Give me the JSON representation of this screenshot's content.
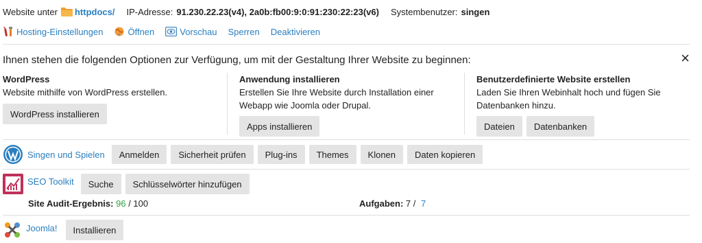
{
  "header": {
    "website_prefix": "Website unter",
    "folder_link": "httpdocs/",
    "ip_label": "IP-Adresse:",
    "ip_value": "91.230.22.23(v4), 2a0b:fb00:9:0:91:230:22:23(v6)",
    "user_label": "Systembenutzer:",
    "user_value": "singen"
  },
  "actions": {
    "hosting": "Hosting-Einstellungen",
    "open": "Öffnen",
    "preview": "Vorschau",
    "lock": "Sperren",
    "deactivate": "Deaktivieren"
  },
  "options": {
    "intro": "Ihnen stehen die folgenden Optionen zur Verfügung, um mit der Gestaltung Ihrer Website zu beginnen:",
    "close": "×",
    "wordpress": {
      "title": "WordPress",
      "text": "Website mithilfe von WordPress erstellen.",
      "button": "WordPress installieren"
    },
    "app": {
      "title": "Anwendung installieren",
      "text1": "Erstellen Sie Ihre Website durch Installation einer",
      "text2": "Webapp wie Joomla oder Drupal.",
      "button": "Apps installieren"
    },
    "custom": {
      "title": "Benutzerdefinierte Website erstellen",
      "text1": "Laden Sie Ihren Webinhalt hoch und fügen Sie",
      "text2": "Datenbanken hinzu.",
      "button_files": "Dateien",
      "button_db": "Datenbanken"
    }
  },
  "wp_site": {
    "name": "Singen und Spielen",
    "buttons": [
      "Anmelden",
      "Sicherheit prüfen",
      "Plug-ins",
      "Themes",
      "Klonen",
      "Daten kopieren"
    ]
  },
  "seo": {
    "name": "SEO Toolkit",
    "buttons": [
      "Suche",
      "Schlüsselwörter hinzufügen"
    ],
    "audit_label": "Site Audit-Ergebnis:",
    "audit_score": "96",
    "audit_total": "/ 100",
    "tasks_label": "Aufgaben:",
    "tasks_value": "7 /",
    "tasks_link": "7"
  },
  "joomla": {
    "name": "Joomla!",
    "button": "Installieren"
  },
  "colors": {
    "link": "#2a7fc0",
    "score": "#2e9e44",
    "button_bg": "#e4e4e4",
    "folder": "#f0a030",
    "seo_icon": "#c0305a"
  },
  "icons": {
    "folder": "folder-icon",
    "hosting": "tools-icon",
    "open": "globe-icon",
    "preview": "eye-icon",
    "wordpress": "wordpress-icon",
    "seo": "seo-chart-icon",
    "joomla": "joomla-icon"
  }
}
